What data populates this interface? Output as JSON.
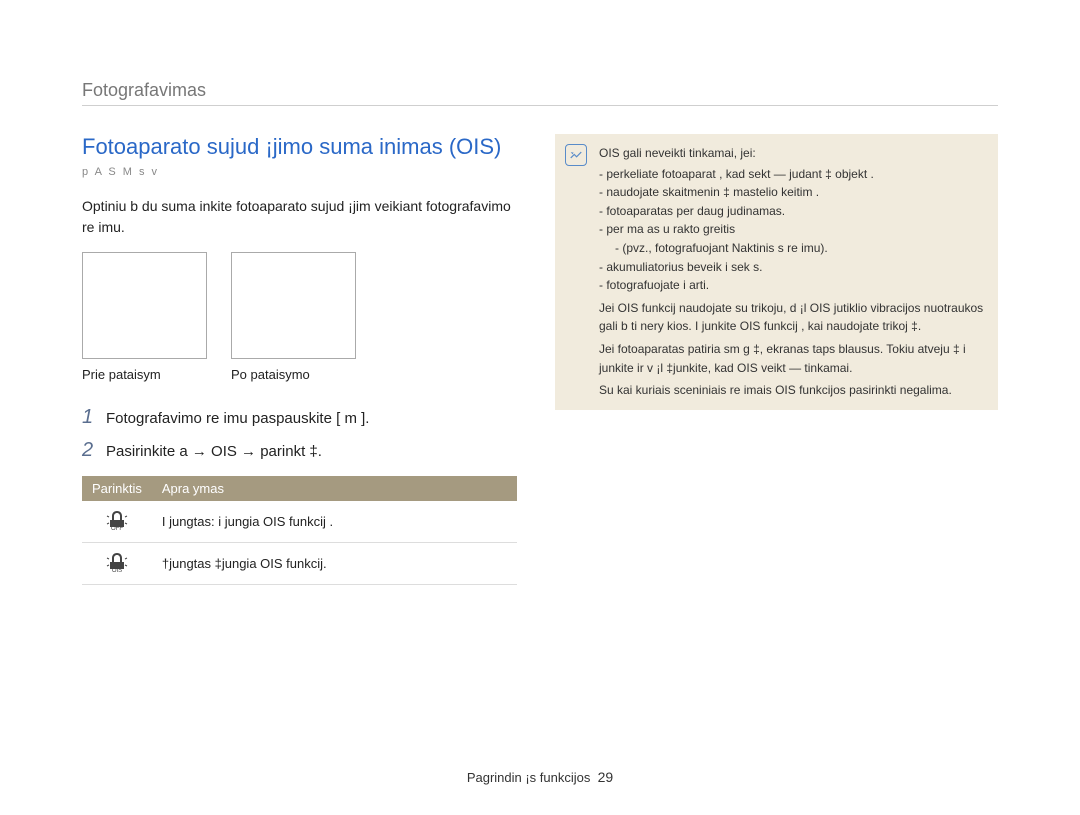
{
  "section_header": "Fotografavimas",
  "title": "Fotoaparato sujud ¡jimo suma inimas (OIS)",
  "modes": "p A S M s v",
  "intro": "Optiniu b du suma inkite fotoaparato sujud ¡jim veikiant fotografavimo re imu.",
  "caption_before": "Prie  pataisym",
  "caption_after": "Po pataisymo",
  "steps": [
    {
      "num": "1",
      "text": "Fotografavimo re imu paspauskite [ m        ]."
    },
    {
      "num": "2",
      "text": "Pasirinkite a     → OIS → parinkt ‡."
    }
  ],
  "table": {
    "h1": "Parinktis",
    "h2": "Apra ymas",
    "rows": [
      {
        "desc": "I jungtas: i jungia OIS funkcij    ."
      },
      {
        "desc": "†jungtas  ‡jungia OIS funkcij."
      }
    ]
  },
  "note": {
    "intro": "OIS gali neveikti tinkamai, jei:",
    "items": [
      "perkeliate fotoaparat , kad sekt — judant ‡ objekt .",
      "naudojate skaitmenin ‡ mastelio keitim .",
      "fotoaparatas per daug judinamas.",
      "per ma as u rakto greitis",
      "(pvz., fotografuojant Naktinis  s        re imu).",
      "akumuliatorius beveik i sek  s.",
      "fotografuojate i  arti."
    ],
    "para1": "Jei OIS funkcij  naudojate su trikoju, d ¡l OIS jutiklio vibracijos nuotraukos gali b ti nery kios. I junkite OIS funkcij , kai naudojate trikoj ‡.",
    "para2": "Jei fotoaparatas patiria sm  g ‡, ekranas taps blausus. Tokiu atveju ‡ i junkite ir v ¡l  ‡junkite, kad OIS veikt — tinkamai.",
    "para3": "Su kai kuriais sceniniais re imais OIS funkcijos pasirinkti negalima."
  },
  "footer_label": "Pagrindin ¡s funkcijos",
  "footer_page": "29"
}
